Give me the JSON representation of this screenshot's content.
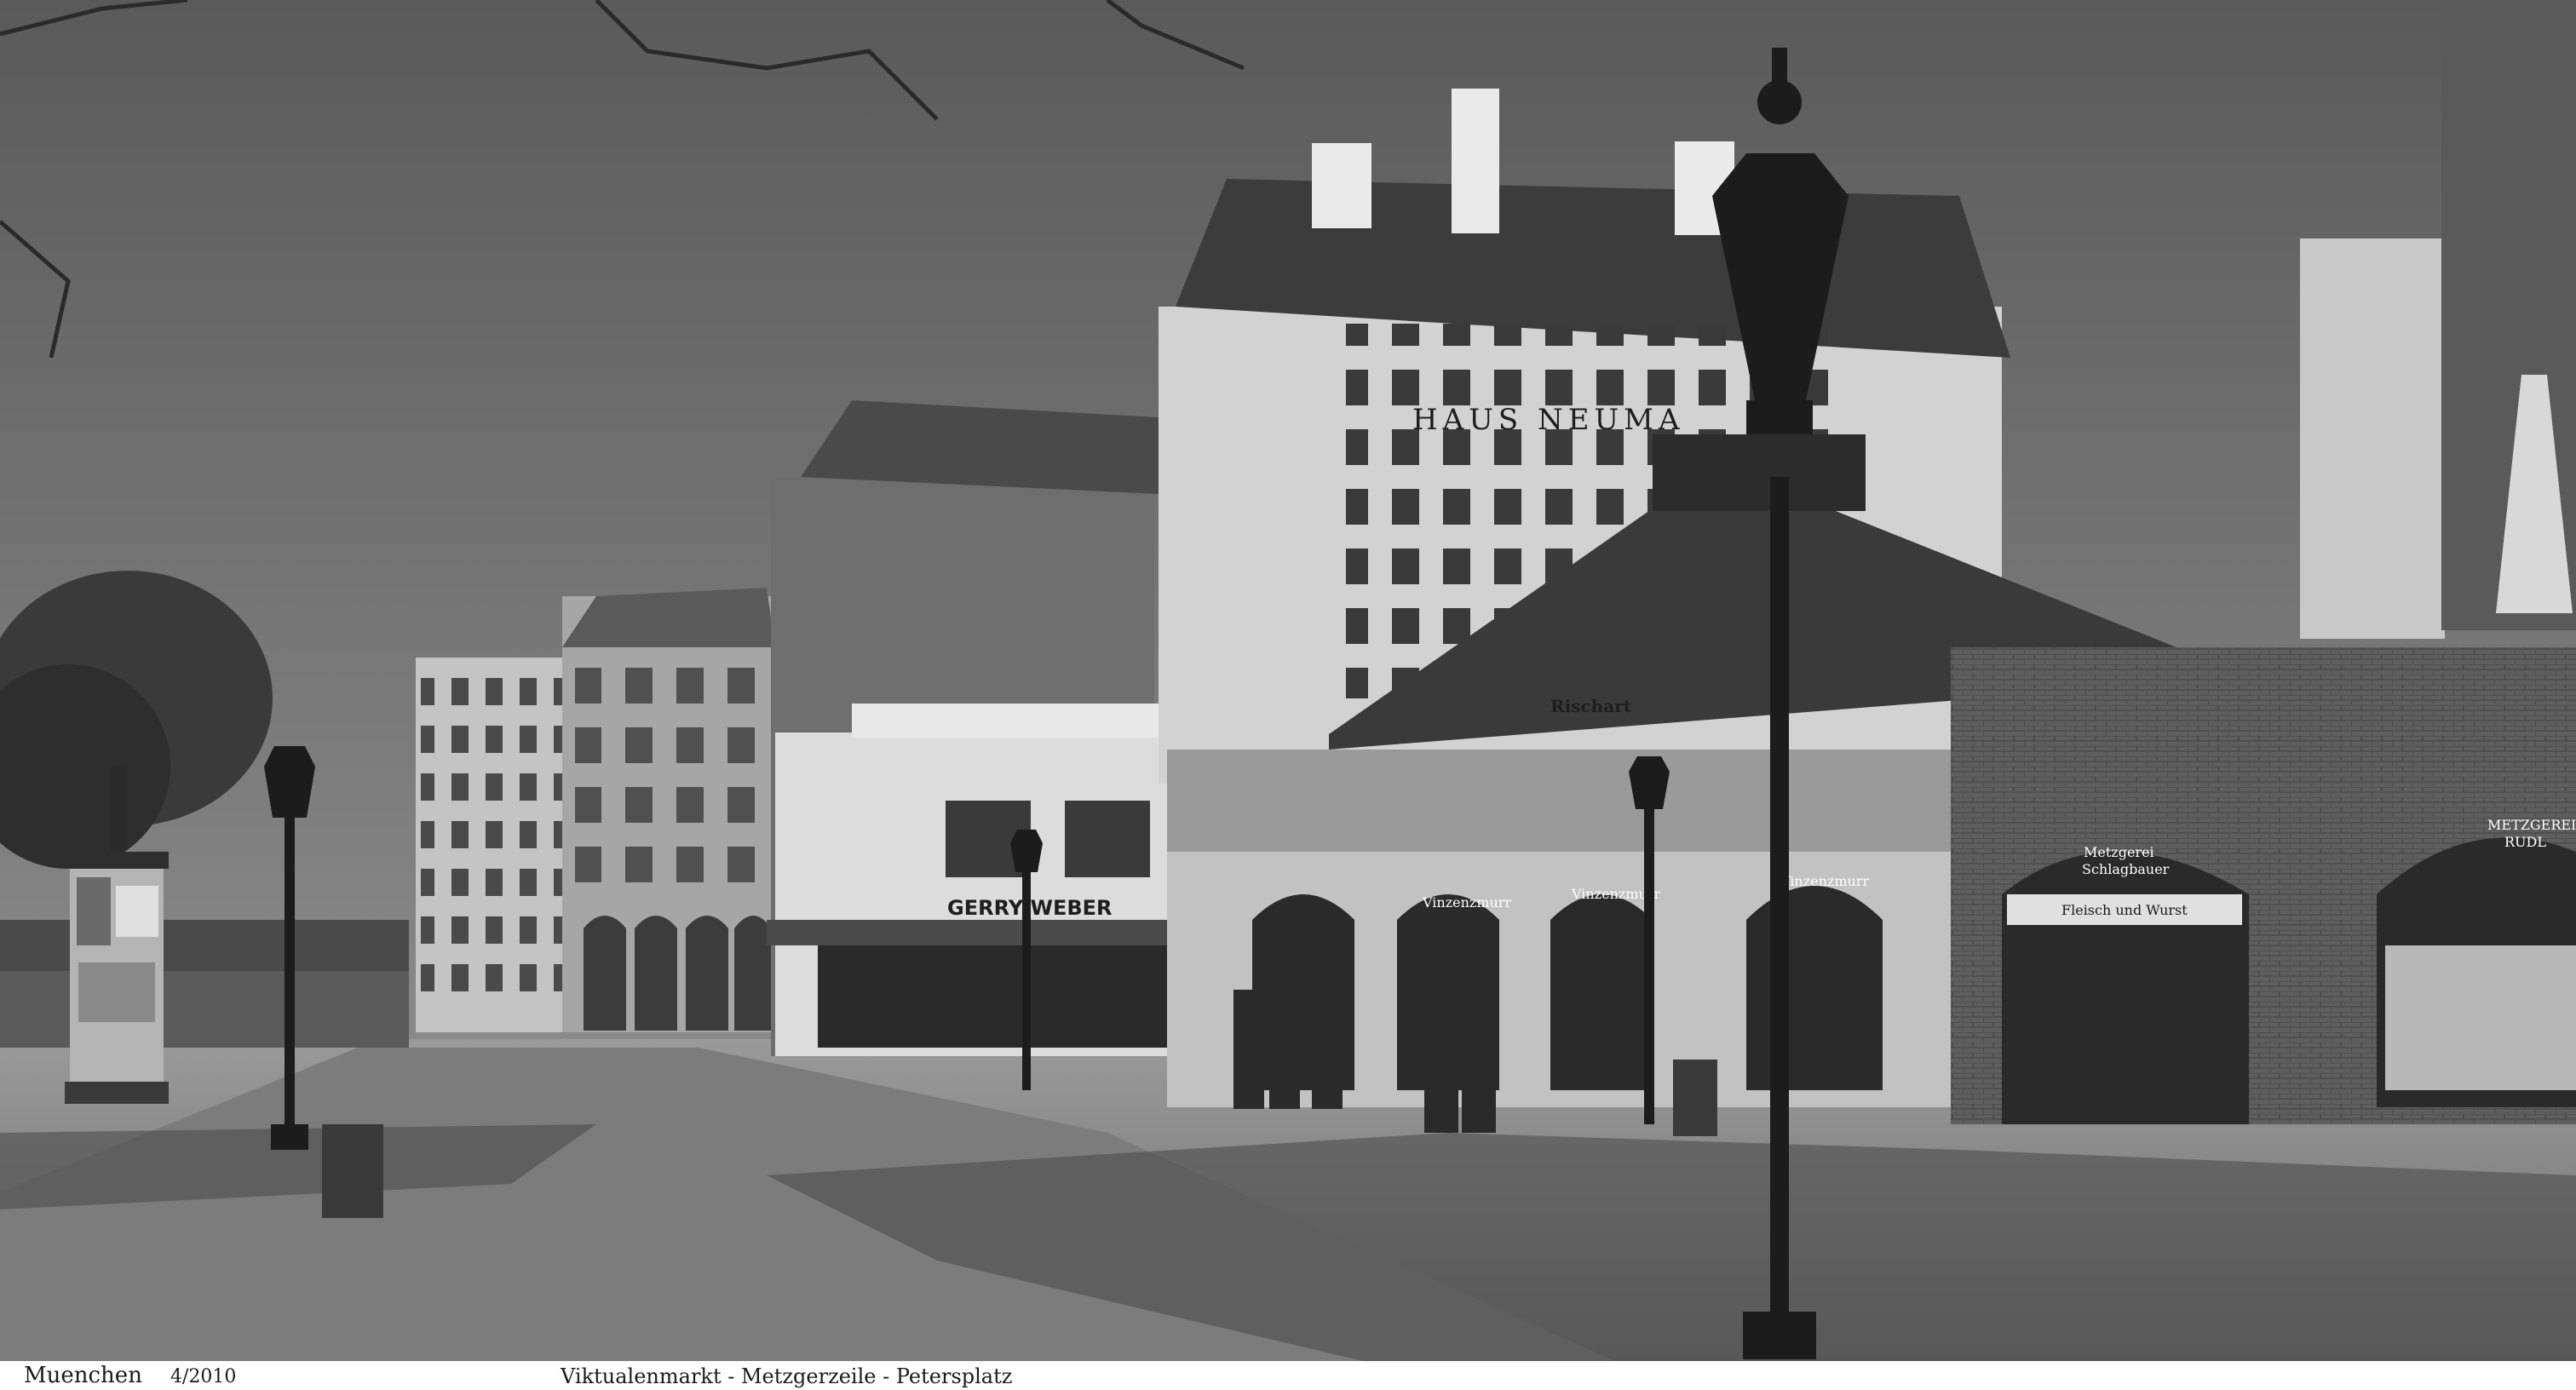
{
  "caption": {
    "city": "Muenchen",
    "date": "4/2010",
    "location": "Viktualenmarkt - Metzgerzeile - Petersplatz"
  },
  "signs": {
    "haus_neumann": "HAUS NEUMA",
    "gerry_weber": "GERRY WEBER",
    "rischart": "Rischart",
    "vinzenzmurr": "Vinzenzmurr",
    "metzgerei_schlagbauer_1": "Metzgerei",
    "metzgerei_schlagbauer_2": "Schlagbauer",
    "fleisch_wurst": "Fleisch und Wurst",
    "metzgerei_rudl_1": "METZGEREI",
    "metzgerei_rudl_2": "RUDL"
  },
  "colors": {
    "sky": "#6c6c6c",
    "ground": "#8a8a8a",
    "shadow": "#3a3a3a",
    "facade_light": "#d8d8d8",
    "brick": "#5a5a5a",
    "roof": "#3c3c3c"
  }
}
